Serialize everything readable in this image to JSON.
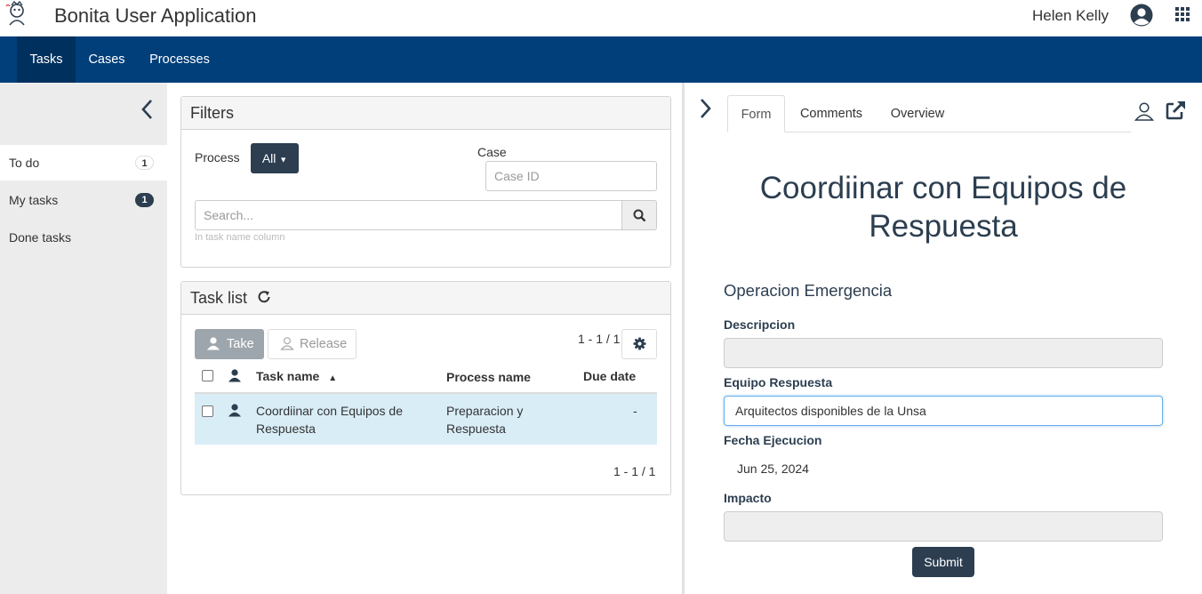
{
  "header": {
    "app_title": "Bonita User Application",
    "user_name": "Helen Kelly",
    "icons": {
      "logo": "bonita-logo-icon",
      "user": "user-circle-icon",
      "apps": "apps-grid-icon"
    }
  },
  "nav": {
    "items": [
      {
        "label": "Tasks",
        "active": true
      },
      {
        "label": "Cases",
        "active": false
      },
      {
        "label": "Processes",
        "active": false
      }
    ]
  },
  "sidebar": {
    "items": [
      {
        "label": "To do",
        "count": "1",
        "active": true
      },
      {
        "label": "My tasks",
        "count": "1",
        "active": false
      },
      {
        "label": "Done tasks",
        "count": "",
        "active": false
      }
    ]
  },
  "filters": {
    "title": "Filters",
    "process_label": "Process",
    "process_value": "All",
    "case_label": "Case",
    "case_placeholder": "Case ID",
    "search_placeholder": "Search...",
    "search_hint": "In task name column"
  },
  "task_list": {
    "title": "Task list",
    "take_label": "Take",
    "release_label": "Release",
    "pager_top": "1 - 1 / 1",
    "pager_bottom": "1 - 1 / 1",
    "columns": [
      "Task name",
      "Process name",
      "Due date"
    ],
    "rows": [
      {
        "task_name": "Coordiinar con Equipos de Respuesta",
        "process_name": "Preparacion y Respuesta",
        "due_date": "-"
      }
    ]
  },
  "detail": {
    "tabs": [
      {
        "label": "Form",
        "active": true
      },
      {
        "label": "Comments",
        "active": false
      },
      {
        "label": "Overview",
        "active": false
      }
    ],
    "form": {
      "title": "Coordiinar con Equipos de Respuesta",
      "section": "Operacion Emergencia",
      "descripcion_label": "Descripcion",
      "descripcion_value": "",
      "equipo_label": "Equipo Respuesta",
      "equipo_value": "Arquitectos disponibles de la Unsa",
      "fecha_label": "Fecha Ejecucion",
      "fecha_value": "Jun 25, 2024",
      "impacto_label": "Impacto",
      "impacto_value": "",
      "submit_label": "Submit"
    }
  },
  "colors": {
    "navbar": "#003f7a",
    "navbar_active": "#00305e",
    "primary_dark": "#2c3e50",
    "selected_row": "#d9edf7",
    "sidebar_bg": "#ececec"
  }
}
